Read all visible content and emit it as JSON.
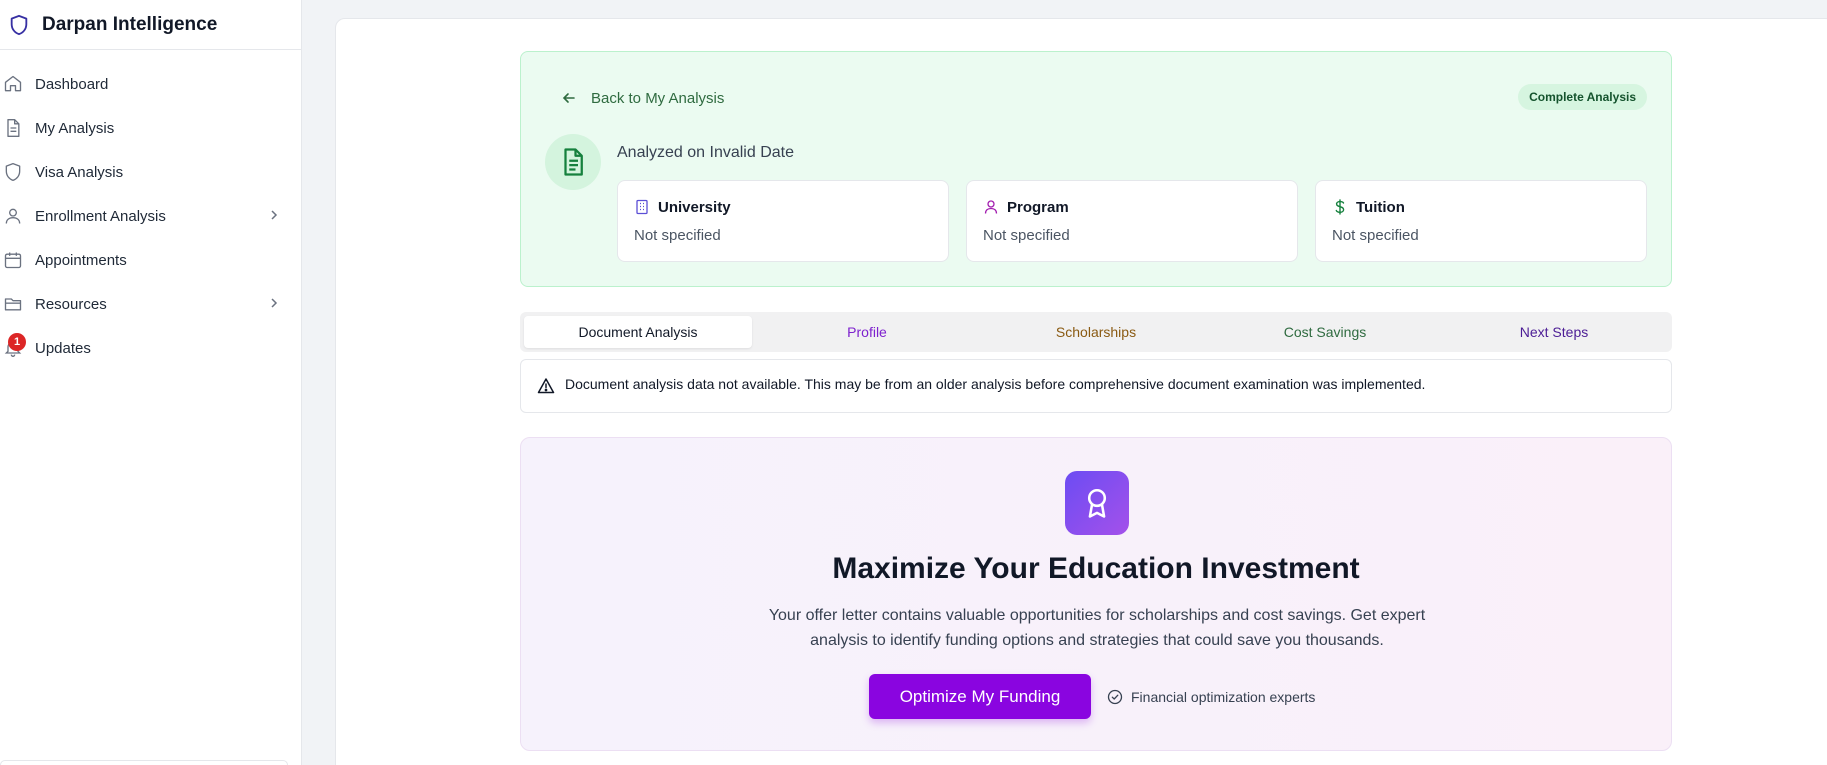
{
  "app": {
    "name": "Darpan Intelligence"
  },
  "sidebar": {
    "items": [
      {
        "label": "Dashboard",
        "icon": "home-icon"
      },
      {
        "label": "My Analysis",
        "icon": "file-icon"
      },
      {
        "label": "Visa Analysis",
        "icon": "shield-icon"
      },
      {
        "label": "Enrollment Analysis",
        "icon": "user-icon",
        "has_submenu": true
      },
      {
        "label": "Appointments",
        "icon": "calendar-icon"
      },
      {
        "label": "Resources",
        "icon": "folder-icon",
        "has_submenu": true
      },
      {
        "label": "Updates",
        "icon": "bell-icon",
        "badge": "1"
      }
    ]
  },
  "analysis": {
    "back_label": "Back to My Analysis",
    "status_badge": "Complete Analysis",
    "analyzed_on": "Analyzed on Invalid Date",
    "cards": [
      {
        "title": "University",
        "value": "Not specified",
        "icon": "building-icon",
        "color": "#5b4fd6"
      },
      {
        "title": "Program",
        "value": "Not specified",
        "icon": "user-icon",
        "color": "#a21caf"
      },
      {
        "title": "Tuition",
        "value": "Not specified",
        "icon": "dollar-icon",
        "color": "#15803d"
      }
    ]
  },
  "tabs": [
    {
      "label": "Document Analysis",
      "active": true,
      "color": "#111827"
    },
    {
      "label": "Profile",
      "color": "#7e22ce"
    },
    {
      "label": "Scholarships",
      "color": "#8a5a12"
    },
    {
      "label": "Cost Savings",
      "color": "#2f6b40"
    },
    {
      "label": "Next Steps",
      "color": "#4c1d95"
    }
  ],
  "alert": {
    "text": "Document analysis data not available. This may be from an older analysis before comprehensive document examination was implemented."
  },
  "promo": {
    "title": "Maximize Your Education Investment",
    "description": "Your offer letter contains valuable opportunities for scholarships and cost savings. Get expert analysis to identify funding options and strategies that could save you thousands.",
    "button_label": "Optimize My Funding",
    "note": "Financial optimization experts"
  },
  "colors": {
    "brand_shield": "#3730a3",
    "success_bg": "#ebfbf1",
    "primary_button": "#8a05e0",
    "notification_badge": "#dc2626"
  }
}
